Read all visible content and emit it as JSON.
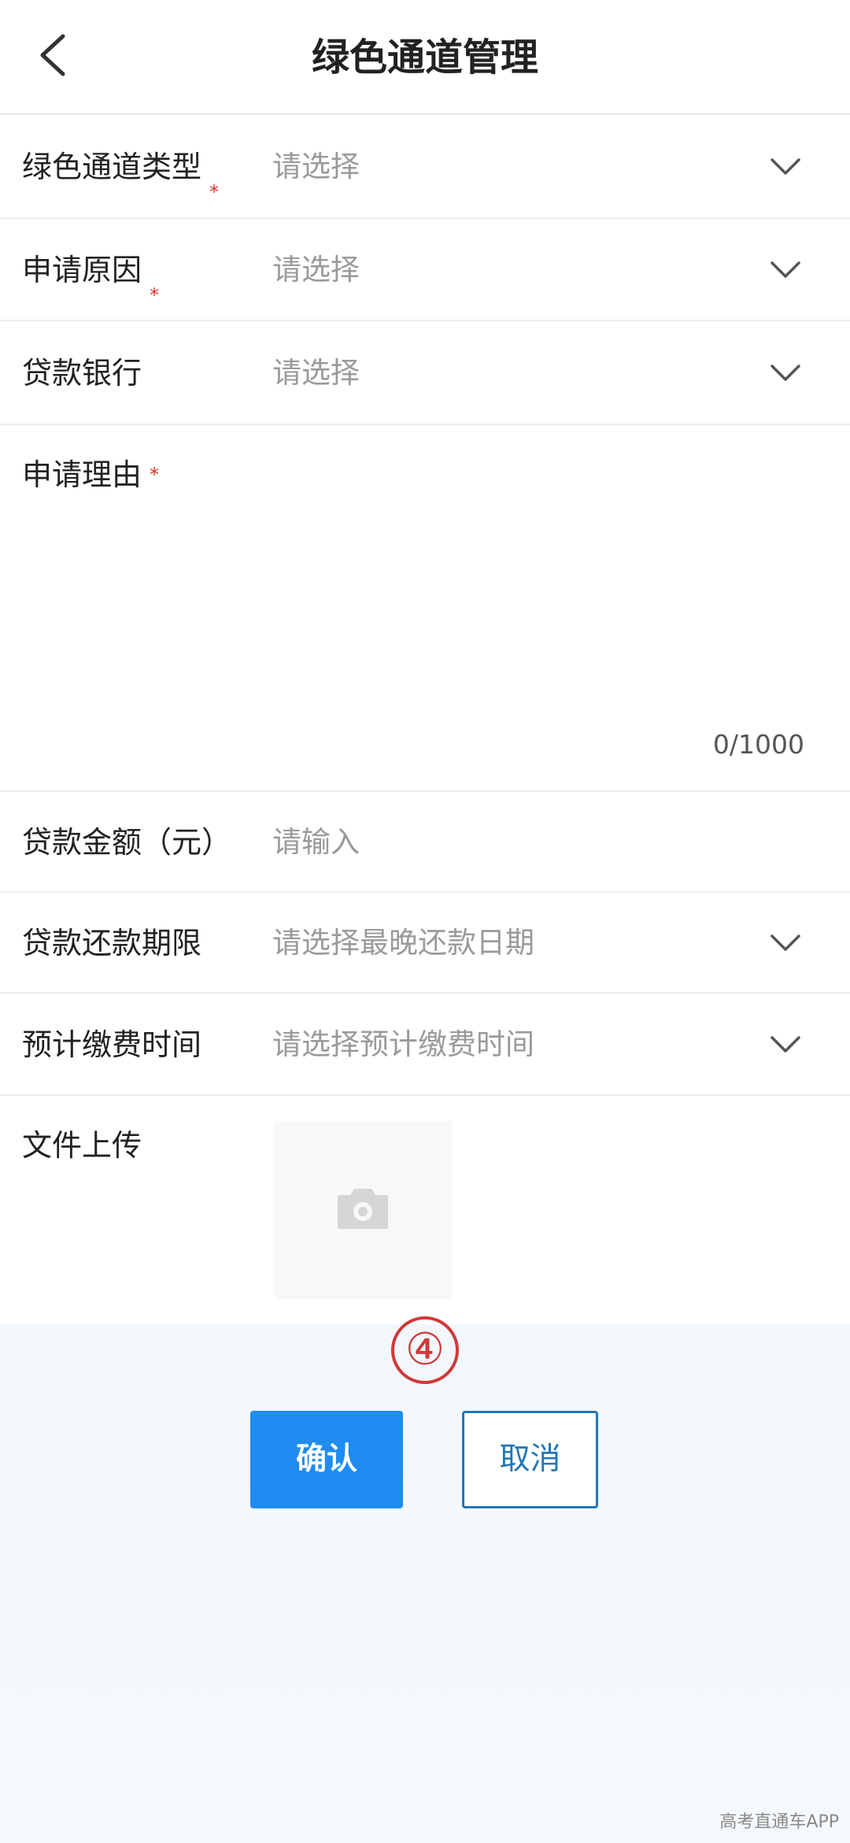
{
  "header": {
    "title": "绿色通道管理"
  },
  "form": {
    "green_channel_type": {
      "label": "绿色通道类型",
      "placeholder": "请选择"
    },
    "apply_cause": {
      "label": "申请原因",
      "placeholder": "请选择"
    },
    "loan_bank": {
      "label": "贷款银行",
      "placeholder": "请选择"
    },
    "apply_reason": {
      "label": "申请理由",
      "value": "",
      "counter": "0/1000"
    },
    "loan_amount": {
      "label": "贷款金额（元）",
      "placeholder": "请输入"
    },
    "repay_deadline": {
      "label": "贷款还款期限",
      "placeholder": "请选择最晚还款日期"
    },
    "payment_time": {
      "label": "预计缴费时间",
      "placeholder": "请选择预计缴费时间"
    },
    "file_upload": {
      "label": "文件上传"
    },
    "required_mark": "*"
  },
  "step_marker": "④",
  "actions": {
    "confirm_label": "确认",
    "cancel_label": "取消"
  },
  "watermark": "高考直通车APP",
  "colors": {
    "primary": "#1e8cf0",
    "cancel_border": "#2176b8",
    "required": "#d9352f",
    "step_marker": "#d0383a"
  }
}
